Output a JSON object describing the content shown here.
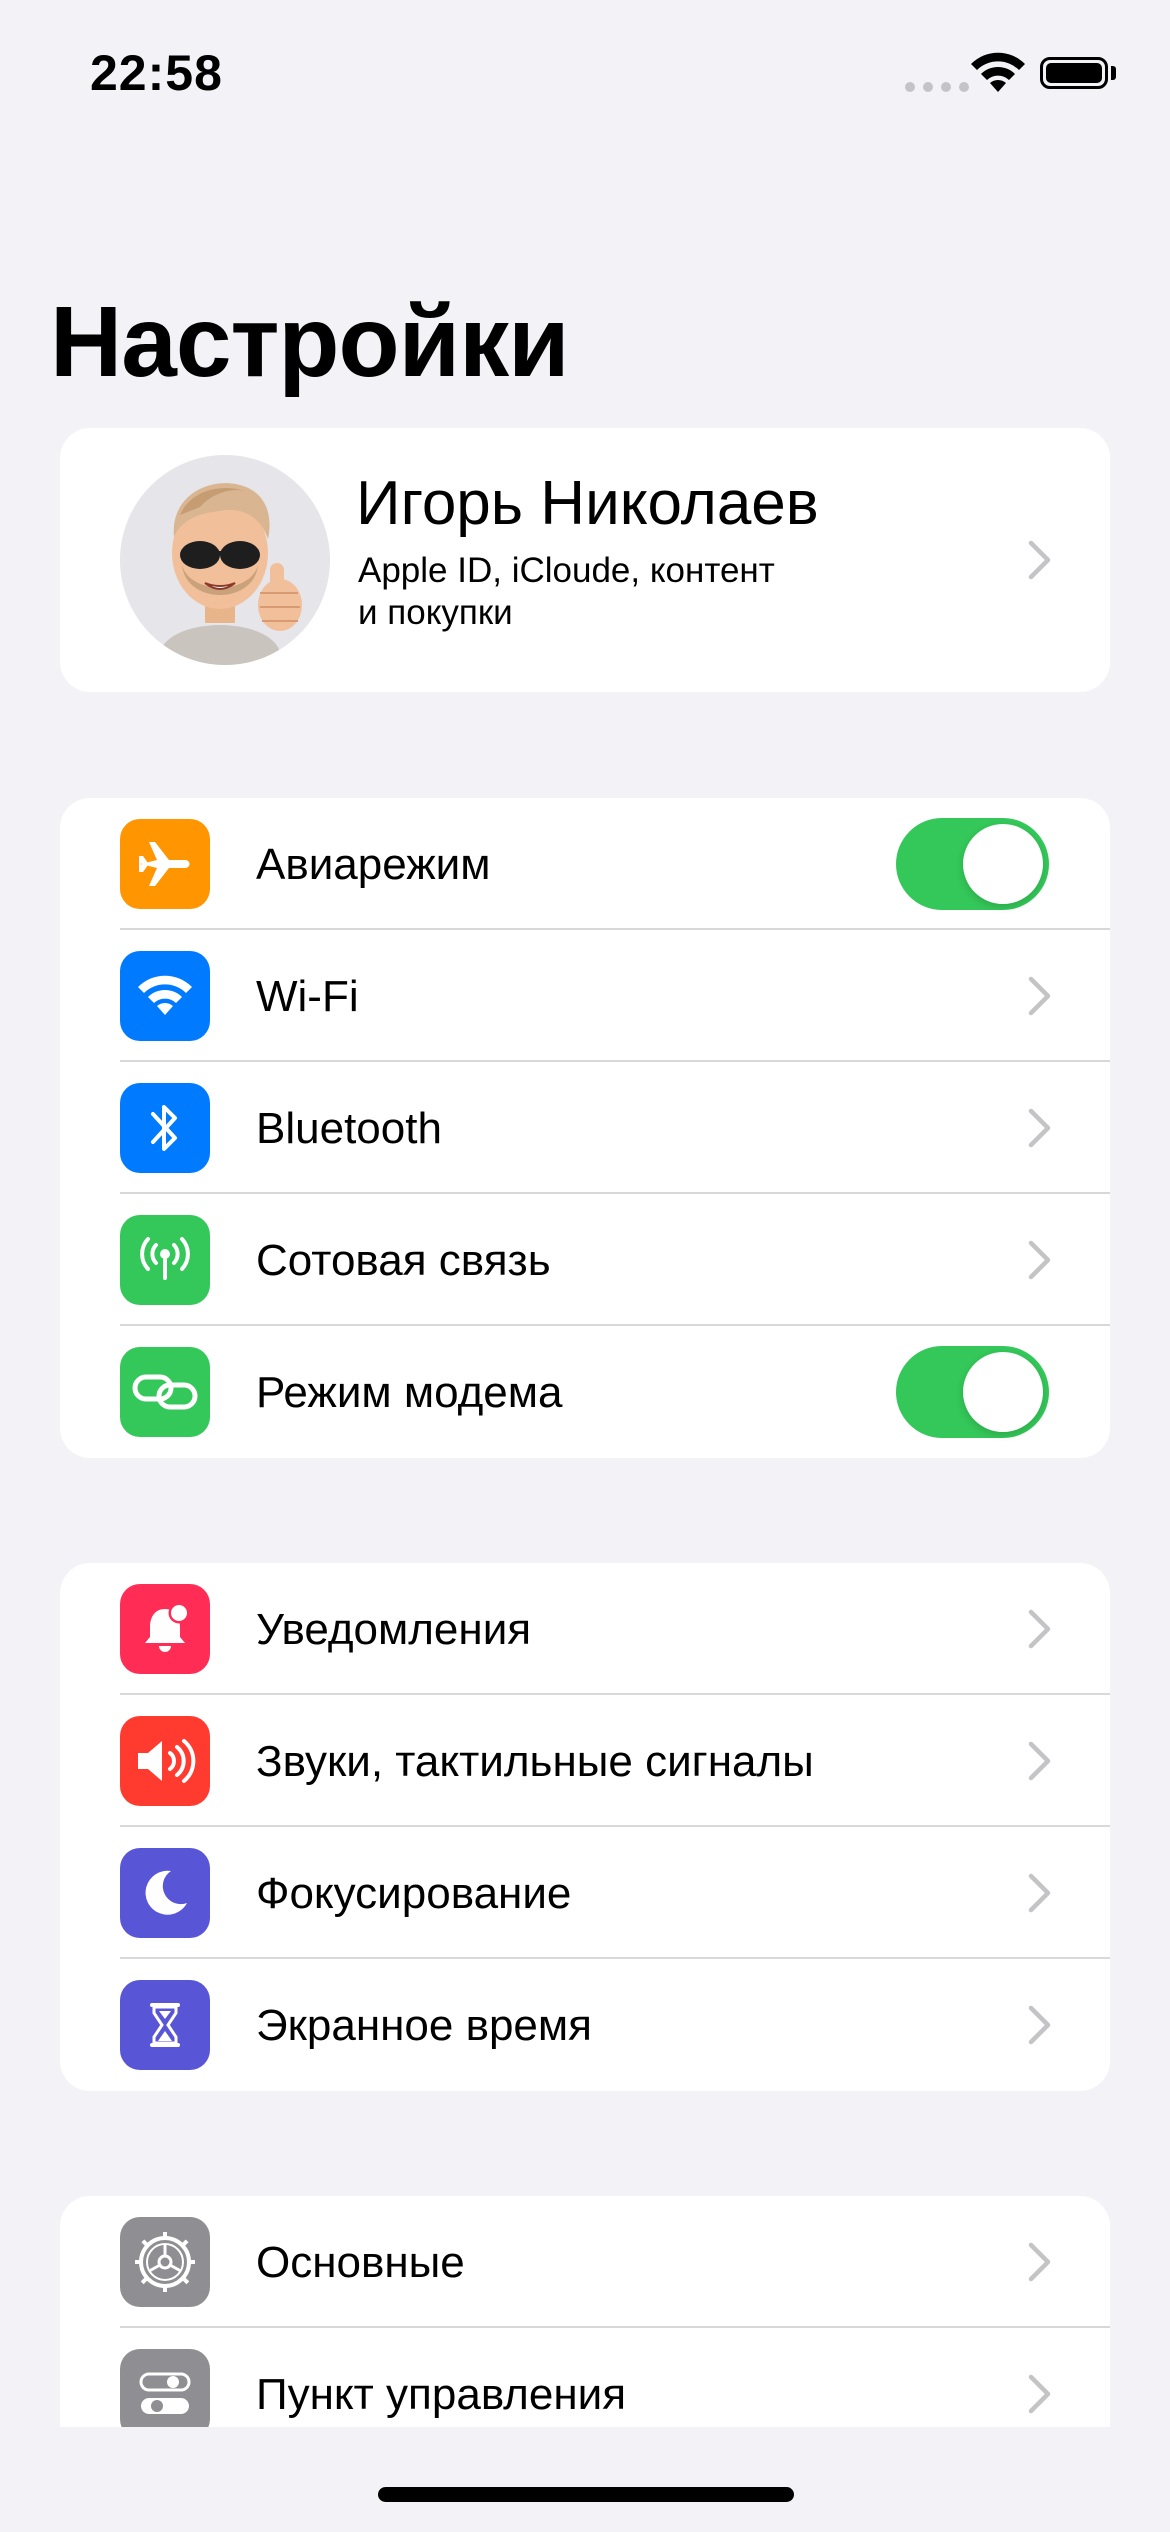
{
  "status_bar": {
    "time": "22:58"
  },
  "page": {
    "title": "Настройки"
  },
  "profile": {
    "name": "Игорь Николаев",
    "subtitle": "Apple ID, iCloude, контент\n и покупки",
    "avatar_icon": "memoji-avatar"
  },
  "group1": [
    {
      "label": "Авиарежим",
      "icon": "airplane-icon",
      "color": "#ff9500",
      "toggle": true
    },
    {
      "label": "Wi-Fi",
      "icon": "wifi-icon",
      "color": "#007aff"
    },
    {
      "label": "Bluetooth",
      "icon": "bluetooth-icon",
      "color": "#007aff"
    },
    {
      "label": "Сотовая связь",
      "icon": "cellular-antenna-icon",
      "color": "#34c759"
    },
    {
      "label": "Режим модема",
      "icon": "personal-hotspot-icon",
      "color": "#34c759",
      "toggle": true
    }
  ],
  "group2": [
    {
      "label": "Уведомления",
      "icon": "notifications-bell-icon",
      "color": "#ff2d55"
    },
    {
      "label": "Звуки, тактильные сигналы",
      "icon": "speaker-icon",
      "color": "#ff3b30"
    },
    {
      "label": "Фокусирование",
      "icon": "moon-icon",
      "color": "#5856d6"
    },
    {
      "label": "Экранное время",
      "icon": "hourglass-icon",
      "color": "#5856d6"
    }
  ],
  "group3": [
    {
      "label": "Основные",
      "icon": "gear-icon",
      "color": "#8e8e93"
    },
    {
      "label": "Пункт управления",
      "icon": "control-center-toggles-icon",
      "color": "#8e8e93"
    }
  ],
  "colors": {
    "toggle_on": "#34c759",
    "background": "#f2f2f7",
    "chevron": "#c4c4c7"
  }
}
